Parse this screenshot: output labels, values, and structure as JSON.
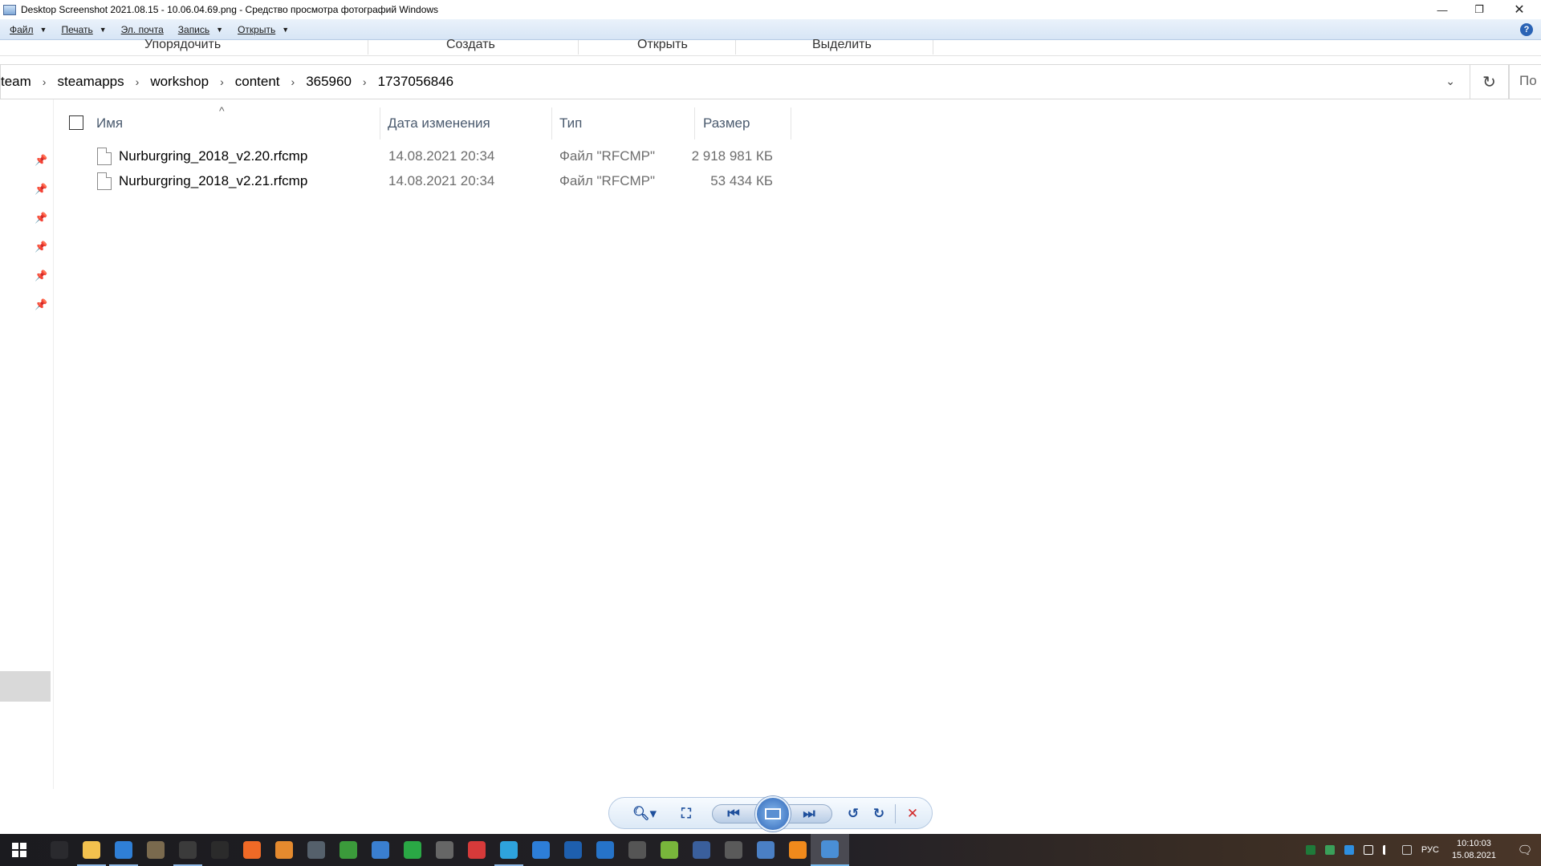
{
  "window": {
    "title": "Desktop Screenshot 2021.08.15 - 10.06.04.69.png - Средство просмотра фотографий Windows",
    "minimize": "—",
    "restore": "❐",
    "close": "✕"
  },
  "menu": {
    "items": [
      {
        "label": "Файл",
        "has_dropdown": true
      },
      {
        "label": "Печать",
        "has_dropdown": true
      },
      {
        "label": "Эл. почта",
        "has_dropdown": false
      },
      {
        "label": "Запись",
        "has_dropdown": true
      },
      {
        "label": "Открыть",
        "has_dropdown": true
      }
    ],
    "help": "?"
  },
  "explorer": {
    "ribbon_groups": [
      "Упорядочить",
      "Создать",
      "Открыть",
      "Выделить"
    ],
    "breadcrumb": [
      "team",
      "steamapps",
      "workshop",
      "content",
      "365960",
      "1737056846"
    ],
    "search_placeholder": "По",
    "columns": {
      "name": "Имя",
      "date": "Дата изменения",
      "type": "Тип",
      "size": "Размер"
    },
    "files": [
      {
        "name": "Nurburgring_2018_v2.20.rfcmp",
        "date": "14.08.2021 20:34",
        "type": "Файл \"RFCMP\"",
        "size": "2 918 981 КБ"
      },
      {
        "name": "Nurburgring_2018_v2.21.rfcmp",
        "date": "14.08.2021 20:34",
        "type": "Файл \"RFCMP\"",
        "size": "53 434 КБ"
      }
    ]
  },
  "taskbar": {
    "apps": [
      {
        "name": "task-view-icon",
        "color": "#2a2a2e"
      },
      {
        "name": "file-explorer-icon",
        "color": "#f2c14e"
      },
      {
        "name": "browser-icon",
        "color": "#2f7fd6"
      },
      {
        "name": "feather-app-icon",
        "color": "#7a6a4e"
      },
      {
        "name": "steam-icon",
        "color": "#3b3b3b"
      },
      {
        "name": "epic-games-icon",
        "color": "#2b2b2b"
      },
      {
        "name": "origin-icon",
        "color": "#f06a26"
      },
      {
        "name": "feather-orange-icon",
        "color": "#e58a2e"
      },
      {
        "name": "game-launcher-icon",
        "color": "#55606b"
      },
      {
        "name": "xbox-icon",
        "color": "#3b9b3b"
      },
      {
        "name": "app-grid-icon",
        "color": "#3a7fd0"
      },
      {
        "name": "fps-monitor-icon",
        "color": "#2aa845"
      },
      {
        "name": "tablet-app-icon",
        "color": "#666666"
      },
      {
        "name": "aida64-icon",
        "color": "#d63a3a"
      },
      {
        "name": "telegram-icon",
        "color": "#2ea3dd"
      },
      {
        "name": "lightning-app-icon",
        "color": "#2d7ed8"
      },
      {
        "name": "bg-app-icon",
        "color": "#1e5fae"
      },
      {
        "name": "gamepad-blue-icon",
        "color": "#2673c8"
      },
      {
        "name": "pen-app-icon",
        "color": "#555555"
      },
      {
        "name": "utorrent-icon",
        "color": "#78b63b"
      },
      {
        "name": "car-app-icon",
        "color": "#3a5f9c"
      },
      {
        "name": "gamepad-icon",
        "color": "#5a5a5a"
      },
      {
        "name": "qbittorrent-icon",
        "color": "#4a7fc4"
      },
      {
        "name": "vlc-icon",
        "color": "#f08a1c"
      },
      {
        "name": "photo-viewer-icon",
        "color": "#4a8fd6"
      }
    ],
    "language": "РУС",
    "time": "10:10:03",
    "date": "15.08.2021"
  },
  "colors": {
    "menubar_top": "#eaf2fb",
    "menubar_bottom": "#d7e5f5",
    "taskbar": "#1b1b1f",
    "viewer_accent": "#2c64b6"
  }
}
